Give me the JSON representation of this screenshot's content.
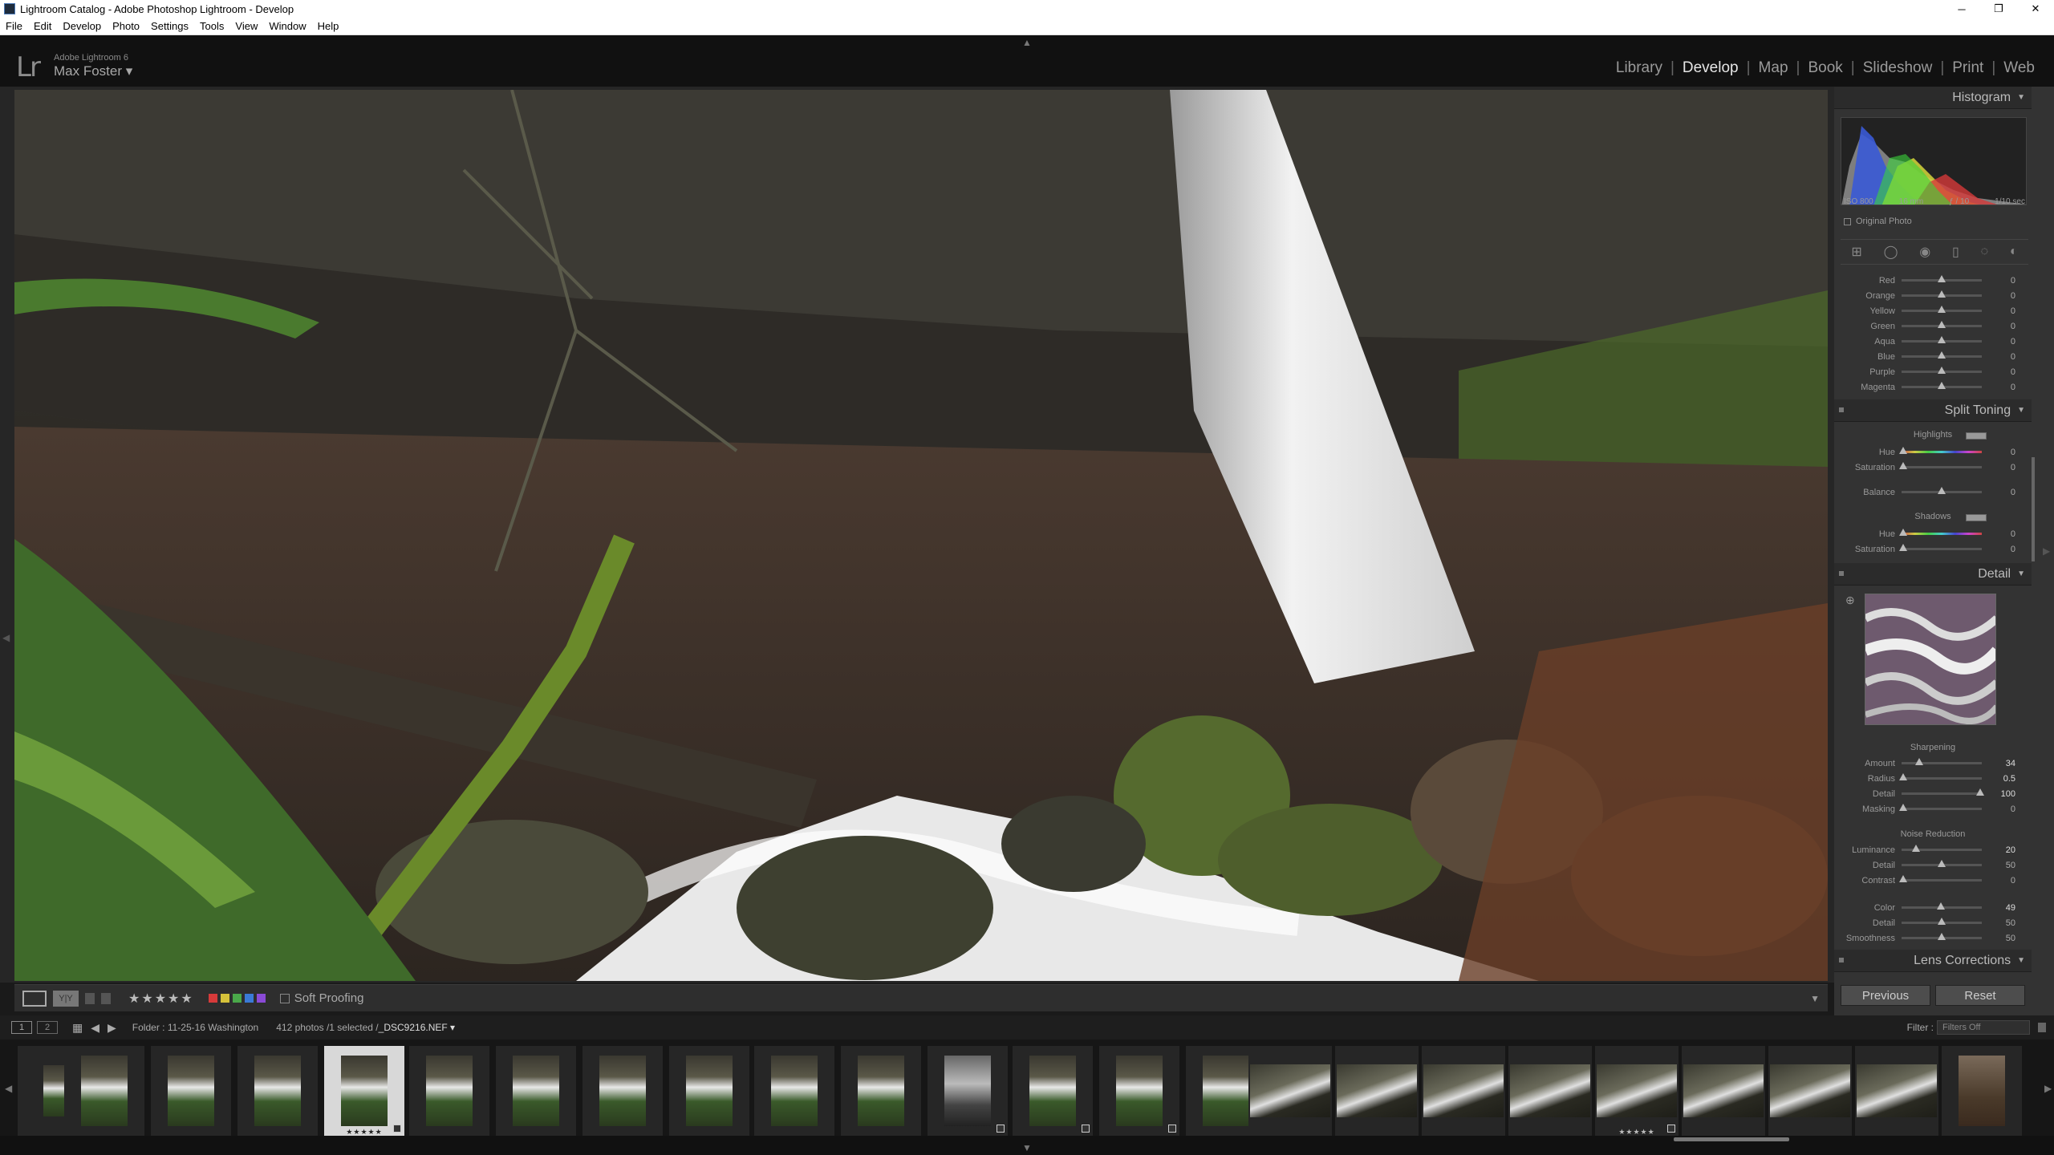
{
  "window": {
    "title": "Lightroom Catalog - Adobe Photoshop Lightroom - Develop",
    "controls": [
      "─",
      "❐",
      "✕"
    ]
  },
  "menu": [
    "File",
    "Edit",
    "Develop",
    "Photo",
    "Settings",
    "Tools",
    "View",
    "Window",
    "Help"
  ],
  "identity": {
    "logo": "Lr",
    "product": "Adobe Lightroom 6",
    "user": "Max Foster ▾"
  },
  "modules": {
    "library": "Library",
    "develop": "Develop",
    "map": "Map",
    "book": "Book",
    "slideshow": "Slideshow",
    "print": "Print",
    "web": "Web",
    "separator": "|"
  },
  "toolbar": {
    "grid_label": "Y|Y",
    "stars": "★★★★★",
    "soft_proofing": "Soft Proofing",
    "color_labels": [
      "#d63a3a",
      "#d6c23a",
      "#4aa84a",
      "#3a7ad6",
      "#8a4ad6"
    ]
  },
  "histogram": {
    "header": "Histogram",
    "iso": "ISO 800",
    "focal": "16 mm",
    "aperture": "ƒ / 10",
    "shutter": "1/10 sec",
    "original_photo": "Original Photo"
  },
  "hsl": {
    "rows": [
      {
        "label": "Red",
        "value": "0"
      },
      {
        "label": "Orange",
        "value": "0"
      },
      {
        "label": "Yellow",
        "value": "0"
      },
      {
        "label": "Green",
        "value": "0"
      },
      {
        "label": "Aqua",
        "value": "0"
      },
      {
        "label": "Blue",
        "value": "0"
      },
      {
        "label": "Purple",
        "value": "0"
      },
      {
        "label": "Magenta",
        "value": "0"
      }
    ]
  },
  "split_toning": {
    "header": "Split Toning",
    "highlights": "Highlights",
    "hue": "Hue",
    "saturation": "Saturation",
    "hue_value": "0",
    "saturation_value": "0",
    "balance": "Balance",
    "balance_value": "0",
    "shadows": "Shadows",
    "shadow_hue_value": "0",
    "shadow_saturation_value": "0"
  },
  "detail": {
    "header": "Detail",
    "sharpening": "Sharpening",
    "amount": "Amount",
    "amount_value": "34",
    "radius": "Radius",
    "radius_value": "0.5",
    "detail": "Detail",
    "detail_value": "100",
    "masking": "Masking",
    "masking_value": "0",
    "noise_reduction": "Noise Reduction",
    "luminance": "Luminance",
    "luminance_value": "20",
    "lum_detail": "Detail",
    "lum_detail_value": "50",
    "contrast": "Contrast",
    "contrast_value": "0",
    "color": "Color",
    "color_value": "49",
    "color_detail": "Detail",
    "color_detail_value": "50",
    "smoothness": "Smoothness",
    "smoothness_value": "50"
  },
  "lens_corrections": {
    "header": "Lens Corrections"
  },
  "buttons": {
    "previous": "Previous",
    "reset": "Reset"
  },
  "filmstrip": {
    "monitor1": "1",
    "monitor2": "2",
    "folder": "Folder : 11-25-16 Washington",
    "count": "412 photos /1 selected /",
    "filename": "_DSC9216.NEF ▾",
    "filter_label": "Filter :",
    "filter_value": "Filters Off",
    "selected_stars": "★★★★★",
    "second_stars": "★★★★★"
  }
}
